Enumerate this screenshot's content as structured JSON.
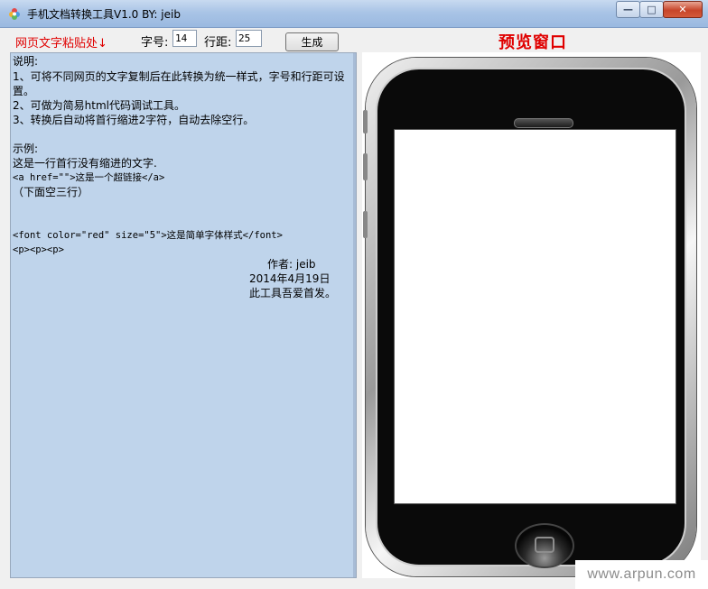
{
  "window": {
    "title": "手机文档转换工具V1.0 BY: jeib",
    "icon": "app-flower-icon",
    "buttons": {
      "minimize": "—",
      "maximize": "□",
      "close": "✕"
    }
  },
  "toolbar": {
    "paste_label": "网页文字粘贴处↓",
    "font_size_label": "字号:",
    "font_size_value": "14",
    "line_spacing_label": "行距:",
    "line_spacing_value": "25",
    "generate_label": "生成",
    "preview_title": "预览窗口"
  },
  "editor": {
    "lines": [
      "说明:",
      "1、可将不同网页的文字复制后在此转换为统一样式，字号和行距可设",
      "置。",
      "2、可做为简易html代码调试工具。",
      "3、转换后自动将首行缩进2字符，自动去除空行。",
      "",
      "示例:",
      "这是一行首行没有缩进的文字.",
      "<a href=\"\">这是一个超链接</a>",
      "（下面空三行）",
      "",
      "",
      "<font color=\"red\" size=\"5\">这是简单字体样式</font>",
      "<p><p><p>"
    ],
    "author": "作者: jeib",
    "date": "2014年4月19日",
    "note": "此工具吾爱首发。"
  },
  "watermark": "www.arpun.com",
  "colors": {
    "accent_red": "#e00000",
    "editor_bg": "#bfd4eb"
  }
}
